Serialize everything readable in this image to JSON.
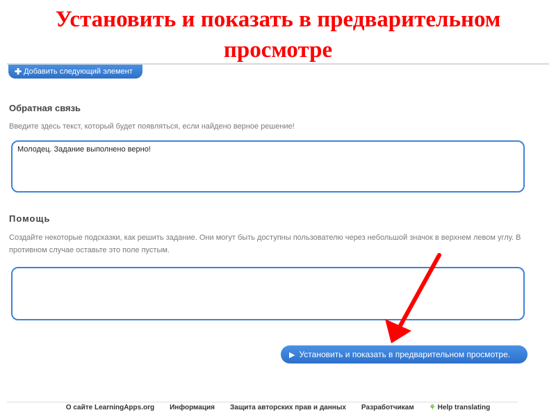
{
  "slide": {
    "title": "Установить и показать в предварительном просмотре",
    "title_color": "#ff0000"
  },
  "toolbar": {
    "add_element_label": "Добавить следующий элемент",
    "add_icon": "plus-icon"
  },
  "feedback": {
    "heading": "Обратная связь",
    "hint": "Введите здесь текст, который будет появляться, если найдено верное решение!",
    "value": "Молодец. Задание выполнено верно!"
  },
  "help": {
    "heading": "Помощь",
    "hint": "Создайте некоторые подсказки, как решить задание. Они могут быть доступны пользователю через небольшой значок в верхнем левом углу. В противном случае оставьте это поле пустым.",
    "value": ""
  },
  "actions": {
    "preview_label": "Установить и показать в предварительном просмотре.",
    "preview_icon": "play-icon",
    "accent_color": "#3d83d7"
  },
  "annotation": {
    "arrow_color": "#ff0000"
  },
  "footer": {
    "links": [
      "О сайте LearningApps.org",
      "Информация",
      "Защита авторских прав и данных",
      "Разработчикам",
      "Help translating"
    ],
    "translate_icon": "translate-icon"
  }
}
